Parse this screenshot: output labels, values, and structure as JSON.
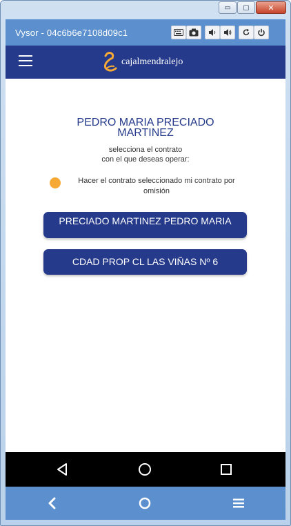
{
  "window": {
    "title": "Vysor - 04c6b6e7108d09c1",
    "controls": {
      "minimize": "▭",
      "maximize": "▢",
      "close": "✕"
    }
  },
  "vysor_toolbar": {
    "icons": [
      "keyboard-icon",
      "camera-icon",
      "volume-down-icon",
      "volume-up-icon",
      "rotate-icon",
      "power-icon"
    ]
  },
  "app": {
    "brand_name": "cajalmendralejo",
    "brand_color": "#253a8a",
    "accent_color": "#f6a935"
  },
  "contract_selection": {
    "user_name": "PEDRO MARIA PRECIADO MARTINEZ",
    "instruction_line1": "selecciona el contrato",
    "instruction_line2": "con el que deseas operar:",
    "default_option_label": "Hacer el contrato seleccionado mi contrato por omisión",
    "contracts": [
      {
        "label": "PRECIADO MARTINEZ PEDRO MARIA"
      },
      {
        "label": "CDAD PROP CL LAS VIÑAS Nº 6"
      }
    ]
  },
  "android_nav": {
    "icons": [
      "back-icon",
      "home-icon",
      "recents-icon"
    ]
  },
  "vysor_bottom_bar": {
    "icons": [
      "back-chevron-icon",
      "home-circle-icon",
      "menu-icon"
    ]
  }
}
